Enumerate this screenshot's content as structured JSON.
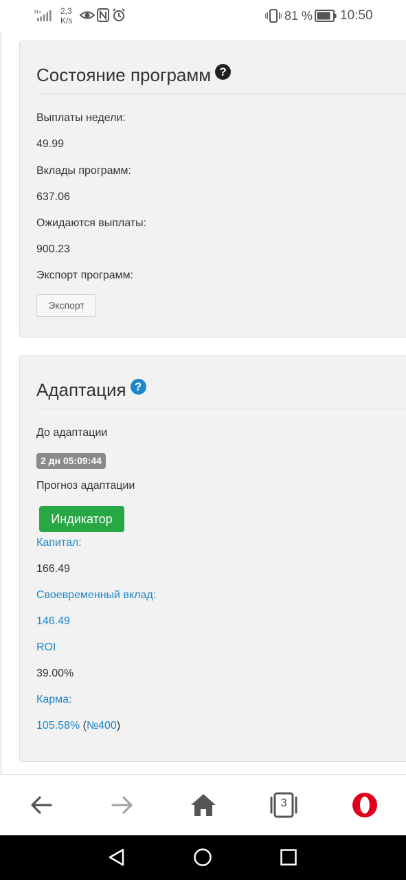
{
  "status_bar": {
    "network_speed_value": "2,3",
    "network_speed_unit": "K/s",
    "battery_percent": "81 %",
    "time": "10:50",
    "icons": [
      "signal-icon",
      "eye-icon",
      "nfc-icon",
      "alarm-icon",
      "vibrate-icon",
      "battery-icon"
    ]
  },
  "program_status": {
    "title": "Состояние программ",
    "help_icon": "?",
    "weekly_payouts_label": "Выплаты недели:",
    "weekly_payouts_value": "49.99",
    "program_deposits_label": "Вклады программ:",
    "program_deposits_value": "637.06",
    "pending_payouts_label": "Ожидаются выплаты:",
    "pending_payouts_value": "900.23",
    "export_label": "Экспорт программ:",
    "export_button": "Экспорт"
  },
  "adaptation": {
    "title": "Адаптация",
    "help_icon": "?",
    "until_label": "До адаптации",
    "until_value": "2 дн 05:09:44",
    "forecast_label": "Прогноз адаптации",
    "indicator_button": "Индикатор",
    "capital_label": "Капитал:",
    "capital_value": "166.49",
    "timely_deposit_label": "Своевременный вклад:",
    "timely_deposit_value": "146.49",
    "roi_label": "ROI",
    "roi_value": "39.00%",
    "karma_label": "Карма:",
    "karma_value": "105.58%",
    "karma_paren_open": " (",
    "karma_rank": "№400",
    "karma_paren_close": ")"
  },
  "browser_toolbar": {
    "tab_count": "3",
    "buttons": [
      "back-arrow-icon",
      "forward-arrow-icon",
      "home-icon",
      "tabs-icon",
      "opera-icon"
    ]
  },
  "colors": {
    "link_blue": "#1b87c9",
    "success_green": "#28a745",
    "badge_gray": "#8a8a8a",
    "panel_bg": "#f2f2f2",
    "opera_red": "#e0001b"
  }
}
